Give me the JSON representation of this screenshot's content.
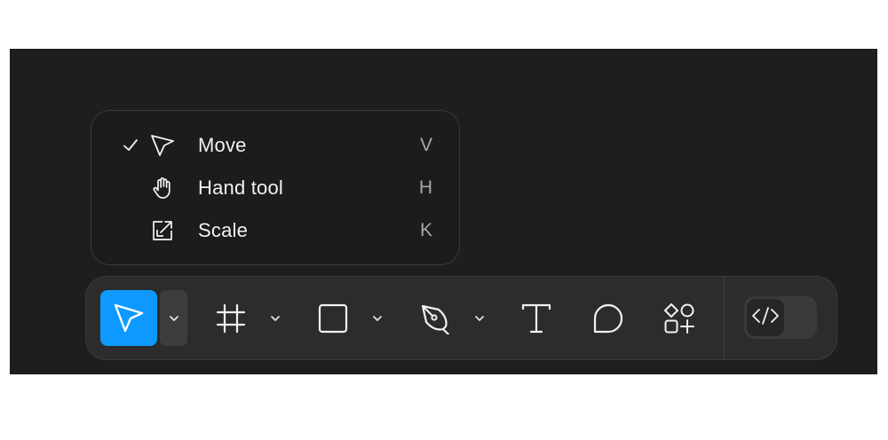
{
  "menu": {
    "items": [
      {
        "label": "Move",
        "shortcut": "V",
        "icon": "cursor-arrow-icon",
        "checked": true
      },
      {
        "label": "Hand tool",
        "shortcut": "H",
        "icon": "hand-icon",
        "checked": false
      },
      {
        "label": "Scale",
        "shortcut": "K",
        "icon": "scale-icon",
        "checked": false
      }
    ]
  },
  "toolbar": {
    "tools": [
      {
        "name": "move",
        "icon": "cursor-arrow-icon",
        "active": true,
        "has_dropdown": true
      },
      {
        "name": "frame",
        "icon": "frame-hash-icon",
        "active": false,
        "has_dropdown": true
      },
      {
        "name": "rectangle",
        "icon": "rectangle-icon",
        "active": false,
        "has_dropdown": true
      },
      {
        "name": "pen",
        "icon": "pen-nib-icon",
        "active": false,
        "has_dropdown": true
      },
      {
        "name": "text",
        "icon": "text-icon",
        "active": false,
        "has_dropdown": false
      },
      {
        "name": "comment",
        "icon": "comment-bubble-icon",
        "active": false,
        "has_dropdown": false
      },
      {
        "name": "actions",
        "icon": "shapes-plus-icon",
        "active": false,
        "has_dropdown": false
      }
    ],
    "dev_mode": {
      "icon": "code-brackets-icon",
      "on": false
    }
  },
  "colors": {
    "accent": "#0d99ff",
    "canvas": "#1e1e1e",
    "toolbar": "#2c2c2c",
    "menu": "#1c1c1c",
    "text": "#f2f2f2",
    "muted": "#a8a8a8"
  }
}
